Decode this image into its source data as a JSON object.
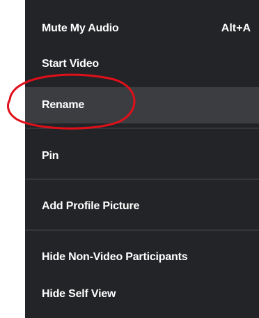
{
  "menu": {
    "items": [
      {
        "label": "Mute My Audio",
        "shortcut": "Alt+A"
      },
      {
        "label": "Start Video"
      },
      {
        "label": "Rename"
      },
      {
        "label": "Pin"
      },
      {
        "label": "Add Profile Picture"
      },
      {
        "label": "Hide Non-Video Participants"
      },
      {
        "label": "Hide Self View"
      }
    ]
  },
  "colors": {
    "menu_background": "#222427",
    "highlight_background": "#3b3d40",
    "annotation_red": "#e0101a",
    "text": "#ffffff"
  }
}
